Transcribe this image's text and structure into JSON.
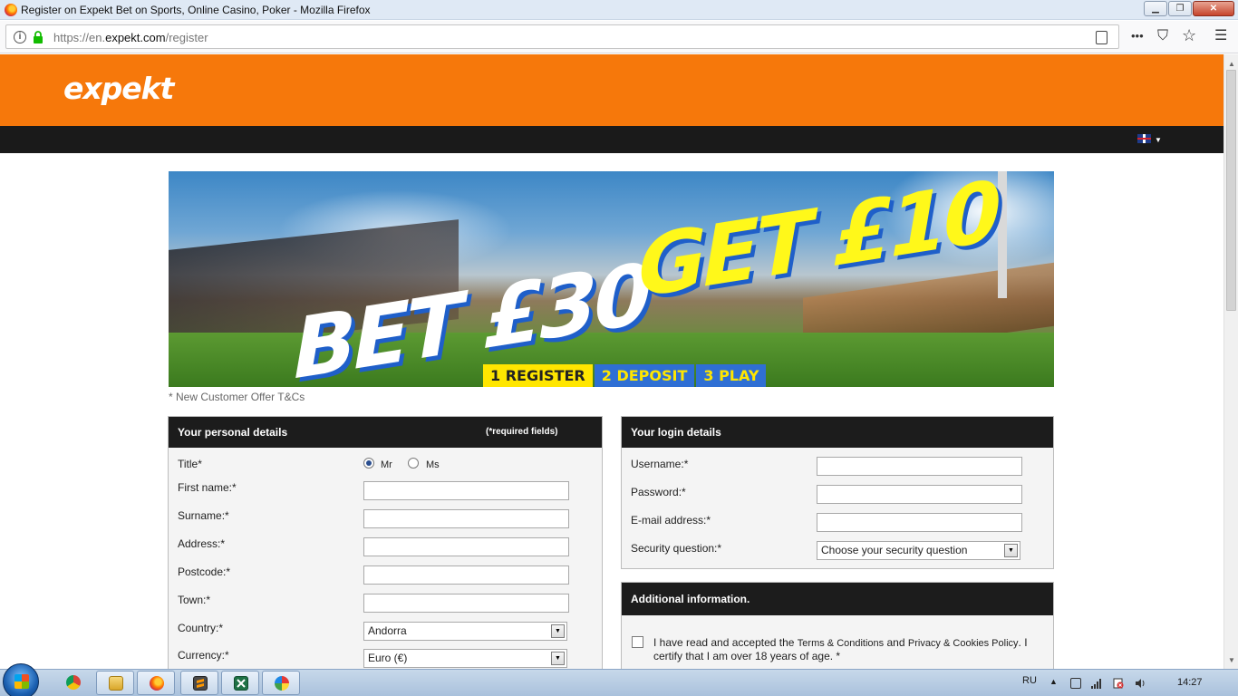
{
  "browser": {
    "window_title": "Register on Expekt Bet on Sports, Online Casino, Poker - Mozilla Firefox",
    "url_prefix": "https://en.",
    "url_domain": "expekt.com",
    "url_path": "/register",
    "min_label": "▁",
    "max_label": "❐",
    "close_label": "✕",
    "page_actions_label": "•••",
    "pocket_label": "⛉",
    "bookmark_label": "☆",
    "menu_label": "☰"
  },
  "site": {
    "logo": "expekt",
    "language_flag": "uk-flag-icon"
  },
  "banner": {
    "slogan_part1": "BET £30",
    "slogan_part2": "GET £10",
    "steps": [
      {
        "label": "1 REGISTER"
      },
      {
        "label": "2 DEPOSIT"
      },
      {
        "label": "3 PLAY"
      }
    ],
    "tcs": "* New Customer Offer T&Cs"
  },
  "personal": {
    "heading": "Your personal details",
    "required_note": "(*required fields)",
    "title_label": "Title*",
    "title_options": [
      {
        "label": "Mr",
        "selected": true
      },
      {
        "label": "Ms",
        "selected": false
      }
    ],
    "first_name_label": "First name:*",
    "first_name_value": "",
    "surname_label": "Surname:*",
    "surname_value": "",
    "address_label": "Address:*",
    "address_value": "",
    "postcode_label": "Postcode:*",
    "postcode_value": "",
    "town_label": "Town:*",
    "town_value": "",
    "country_label": "Country:*",
    "country_value": "Andorra",
    "currency_label": "Currency:*",
    "currency_value": "Euro (€)"
  },
  "login": {
    "heading": "Your login details",
    "username_label": "Username:*",
    "username_value": "",
    "password_label": "Password:*",
    "password_value": "",
    "email_label": "E-mail address:*",
    "email_value": "",
    "security_label": "Security question:*",
    "security_value": "Choose your security question"
  },
  "additional": {
    "heading": "Additional information.",
    "terms_line1_a": "I have read and accepted the ",
    "terms_link1": "Terms & Conditions",
    "terms_line1_b": " and ",
    "terms_link2": "Privacy & Cookies Policy",
    "terms_line1_c": ". I",
    "terms_line2": "certify that I am over 18 years of age. *"
  },
  "taskbar": {
    "language": "RU",
    "time": "14:27",
    "apps": [
      "chrome-icon",
      "explorer-icon",
      "firefox-icon",
      "sublime-icon",
      "excel-icon",
      "paint-icon"
    ]
  }
}
